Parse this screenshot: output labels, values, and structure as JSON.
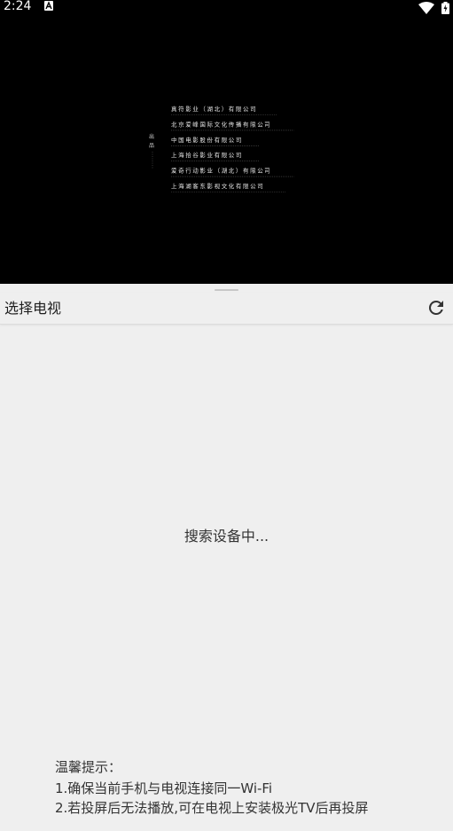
{
  "status_bar": {
    "time": "2:24",
    "notification_icon": "a-notification-icon",
    "wifi_icon": "wifi-icon",
    "battery_icon": "battery-charging-icon"
  },
  "video": {
    "credit_side_label": "出品",
    "credits": [
      "真符影业（湖北）有限公司",
      "北京爱峰国际文化传播有限公司",
      "中国电影股份有限公司",
      "上海拾谷影业有限公司",
      "爱奇行动影业（湖北）有限公司",
      "上海湖客东影视文化有限公司"
    ]
  },
  "sheet": {
    "title": "选择电视",
    "refresh_icon": "refresh-icon",
    "searching_text": "搜索设备中...",
    "tips": {
      "title": "温馨提示：",
      "items": [
        "1.确保当前手机与电视连接同一Wi-Fi",
        "2.若投屏后无法播放,可在电视上安装极光TV后再投屏"
      ]
    }
  },
  "colors": {
    "video_background": "#000000",
    "sheet_background": "#efefef",
    "text_primary": "#1f1f1f",
    "text_secondary": "#333333"
  }
}
